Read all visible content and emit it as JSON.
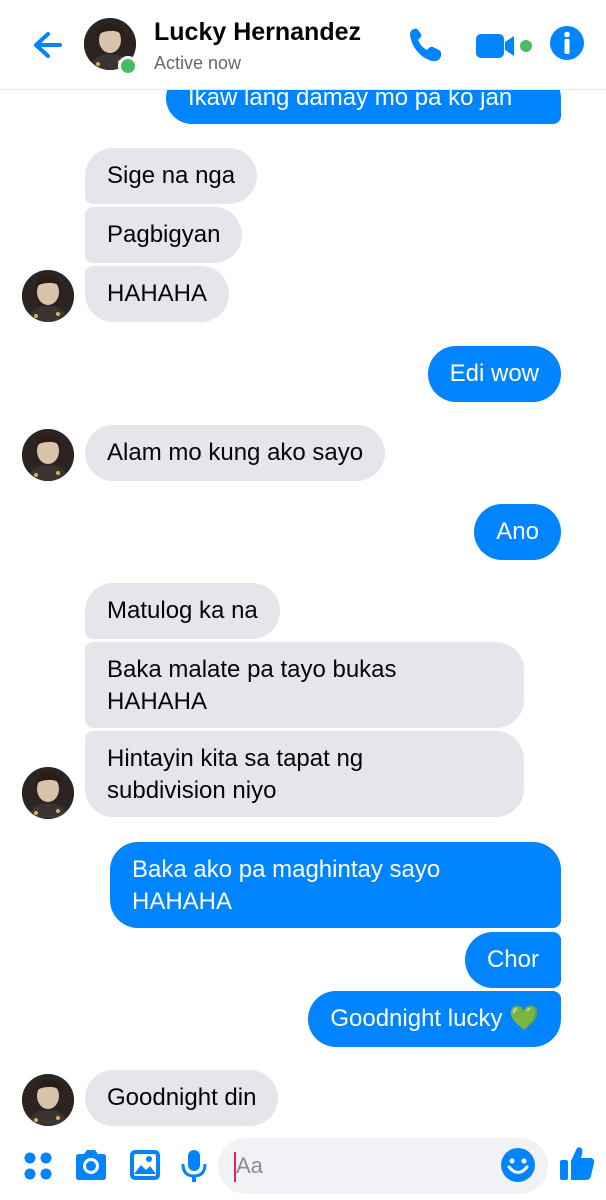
{
  "header": {
    "contact_name": "Lucky Hernandez",
    "status": "Active now",
    "icons": [
      "back-arrow-icon",
      "phone-icon",
      "video-camera-icon",
      "info-icon"
    ],
    "accent_color": "#0084ff",
    "online_color": "#45bd62"
  },
  "messages": [
    {
      "from": "me",
      "text": "Ikaw lang damay mo pa ko jan"
    },
    {
      "from": "them",
      "text": "Sige na nga"
    },
    {
      "from": "them",
      "text": "Pagbigyan"
    },
    {
      "from": "them",
      "text": "HAHAHA"
    },
    {
      "from": "me",
      "text": "Edi wow"
    },
    {
      "from": "them",
      "text": "Alam mo kung ako sayo"
    },
    {
      "from": "me",
      "text": "Ano"
    },
    {
      "from": "them",
      "text": "Matulog ka na"
    },
    {
      "from": "them",
      "text": "Baka malate pa tayo bukas\nHAHAHA"
    },
    {
      "from": "them",
      "text": "Hintayin kita sa tapat ng\nsubdivision niyo"
    },
    {
      "from": "me",
      "text": "Baka ako pa maghintay sayo\nHAHAHA"
    },
    {
      "from": "me",
      "text": "Chor"
    },
    {
      "from": "me",
      "text": "Goodnight lucky 💚"
    },
    {
      "from": "them",
      "text": "Goodnight din"
    }
  ],
  "composer": {
    "placeholder": "Aa",
    "icons": [
      "menu-dots-icon",
      "camera-icon",
      "gallery-icon",
      "microphone-icon",
      "emoji-icon",
      "thumbs-up-icon"
    ]
  },
  "colors": {
    "incoming_bubble": "#e4e6eb",
    "outgoing_bubble": "#0084ff"
  }
}
